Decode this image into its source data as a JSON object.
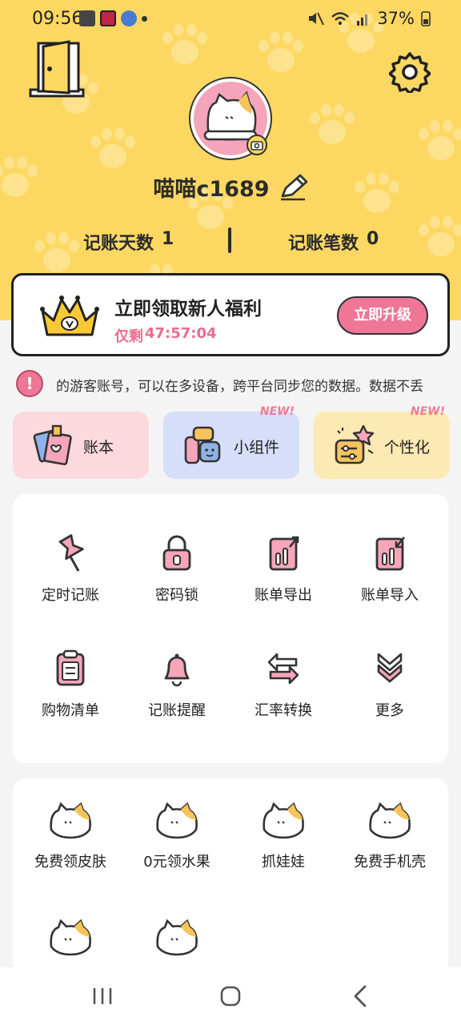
{
  "status_bar": {
    "time": "09:56",
    "battery": "37%"
  },
  "profile": {
    "username": "喵喵c1689",
    "stats": {
      "days_label": "记账天数",
      "days_value": "1",
      "count_label": "记账笔数",
      "count_value": "0"
    }
  },
  "promo": {
    "title": "立即领取新人福利",
    "timer_prefix": "仅剩",
    "timer_value": "47:57:04",
    "button_label": "立即升级"
  },
  "notice": {
    "text": "的游客账号，可以在多设备，跨平台同步您的数据。数据不丢"
  },
  "tiles": [
    {
      "label": "账本",
      "new": ""
    },
    {
      "label": "小组件",
      "new": "NEW!"
    },
    {
      "label": "个性化",
      "new": "NEW!"
    }
  ],
  "tools": [
    {
      "label": "定时记账",
      "icon": "pin-icon"
    },
    {
      "label": "密码锁",
      "icon": "lock-icon"
    },
    {
      "label": "账单导出",
      "icon": "export-icon"
    },
    {
      "label": "账单导入",
      "icon": "import-icon"
    },
    {
      "label": "购物清单",
      "icon": "clipboard-icon"
    },
    {
      "label": "记账提醒",
      "icon": "bell-icon"
    },
    {
      "label": "汇率转换",
      "icon": "exchange-icon"
    },
    {
      "label": "更多",
      "icon": "chevrons-down-icon"
    }
  ],
  "free_items": [
    {
      "label": "免费领皮肤"
    },
    {
      "label": "0元领水果"
    },
    {
      "label": "抓娃娃"
    },
    {
      "label": "免费手机壳"
    },
    {
      "label": ""
    },
    {
      "label": ""
    }
  ],
  "colors": {
    "header_bg": "#fcd862",
    "accent_pink": "#ef7696",
    "timer_pink": "#ea6c8f",
    "tile_pink": "#fbd9df",
    "tile_blue": "#d6def9",
    "tile_yellow": "#fde9b3"
  }
}
